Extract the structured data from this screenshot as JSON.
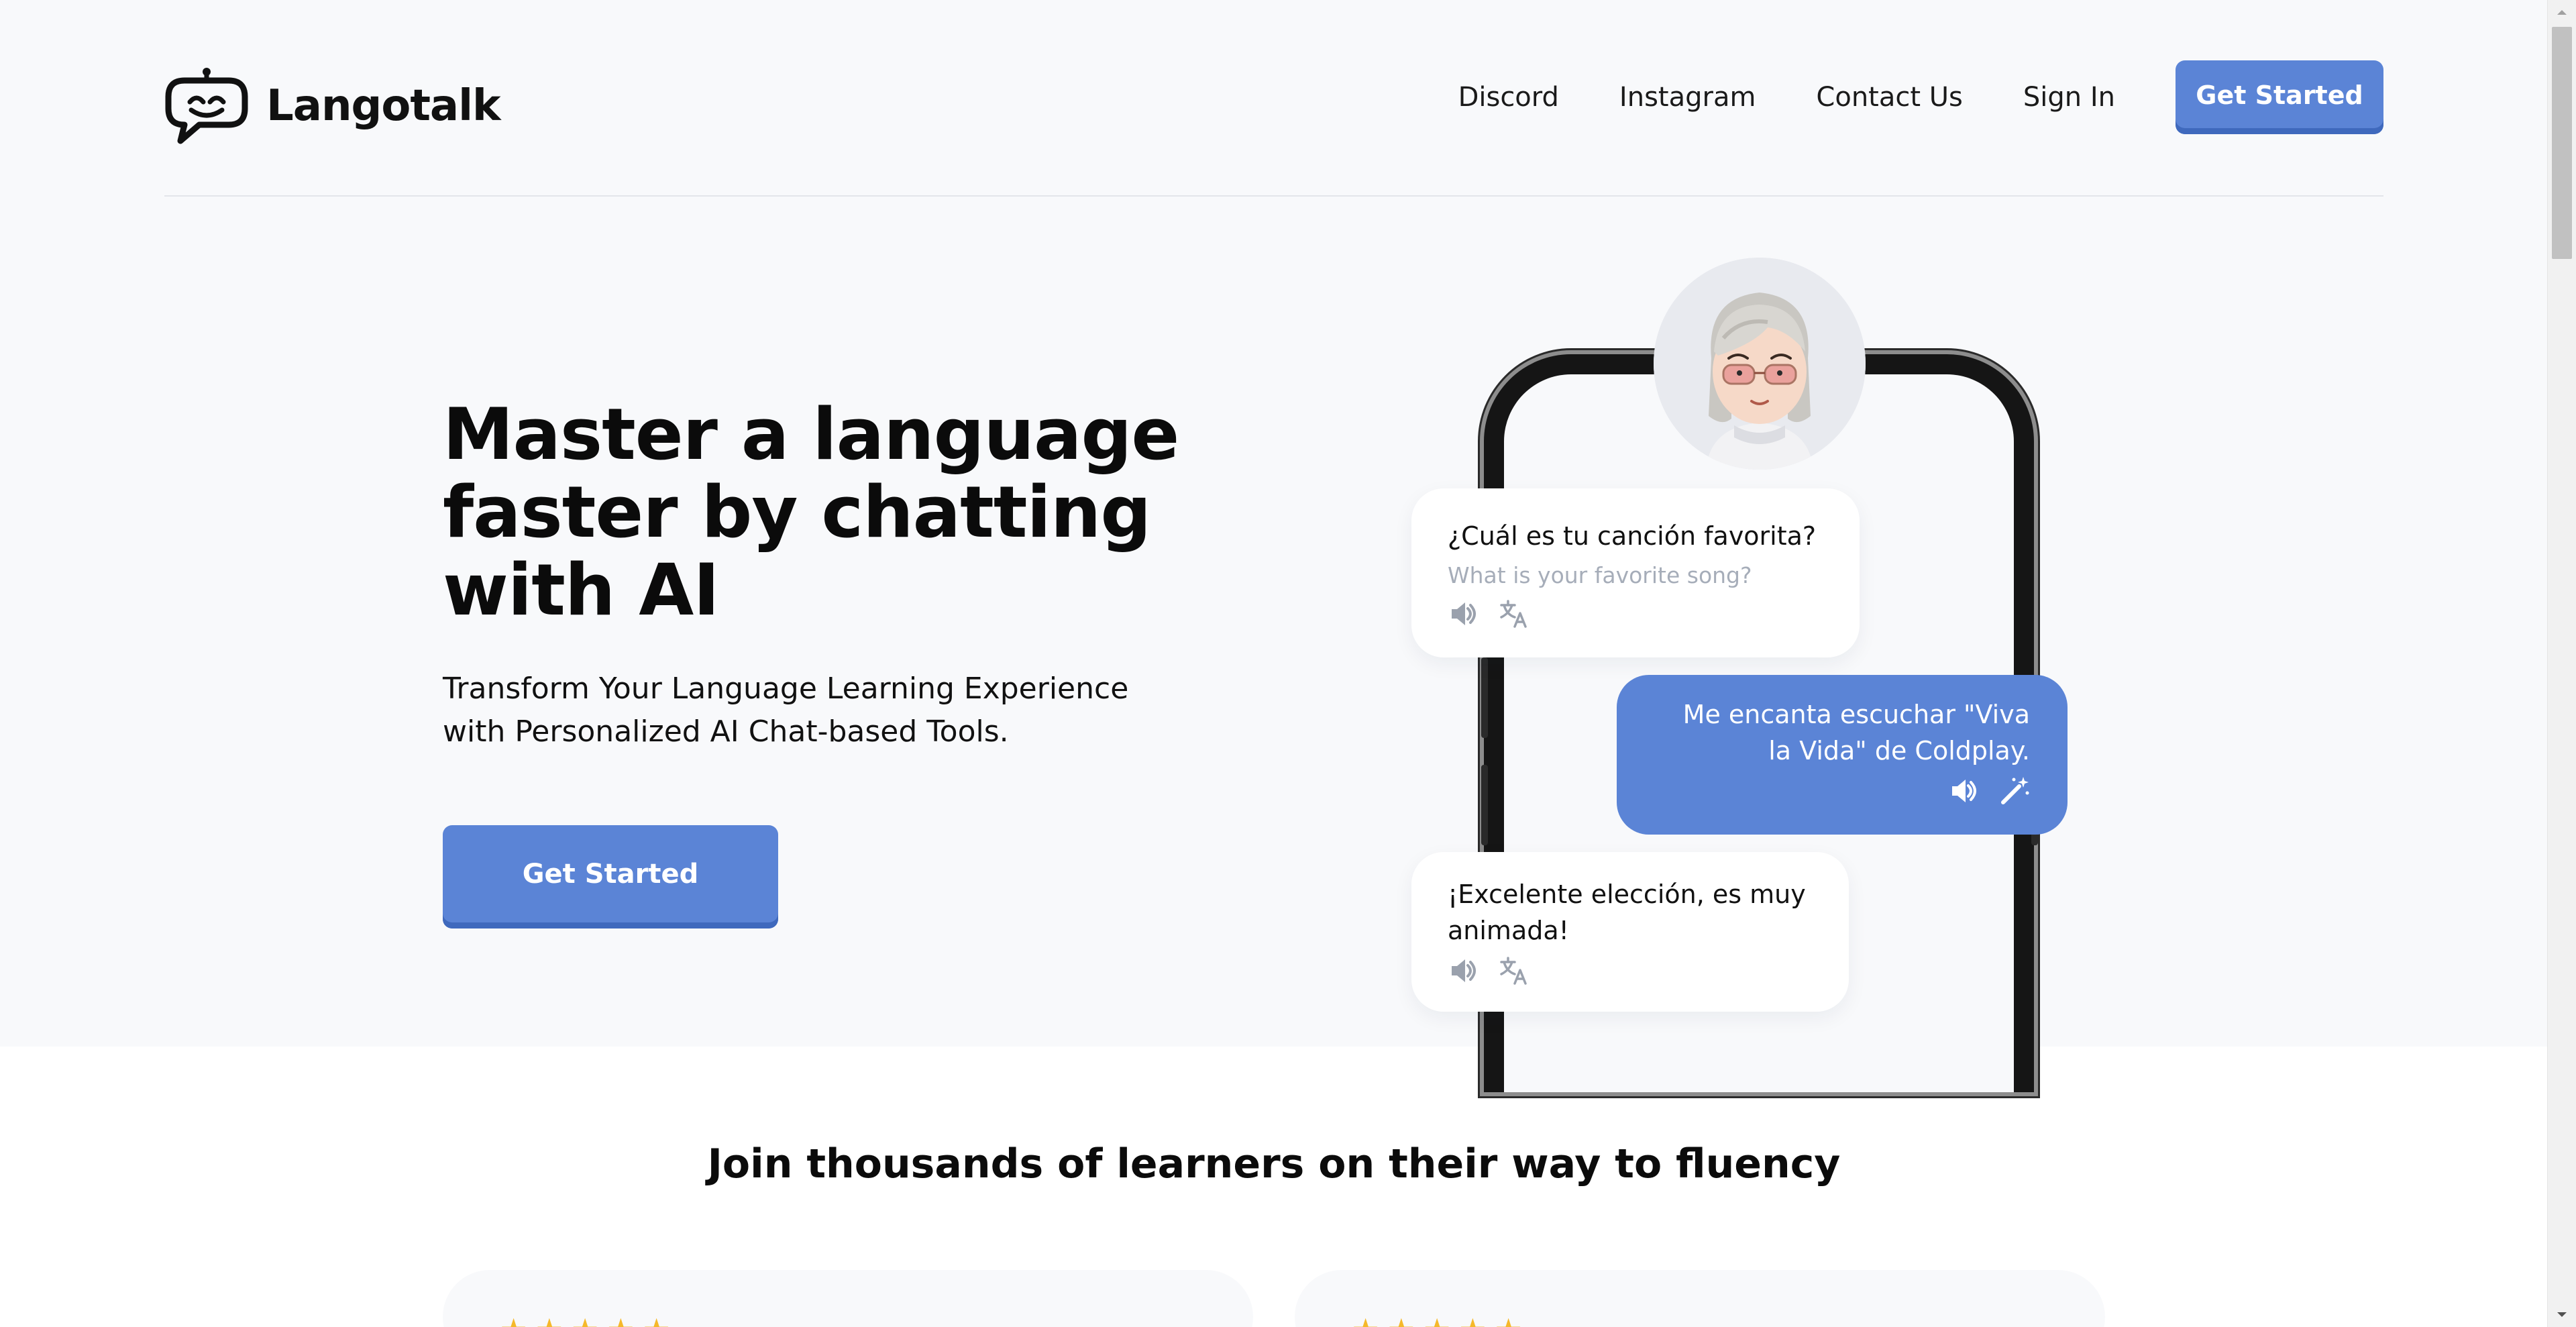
{
  "brand": {
    "name": "Langotalk",
    "logo_icon": "chat-bubble-smile-icon"
  },
  "nav": {
    "links": [
      {
        "label": "Discord"
      },
      {
        "label": "Instagram"
      },
      {
        "label": "Contact Us"
      },
      {
        "label": "Sign In"
      }
    ],
    "cta_label": "Get Started"
  },
  "hero": {
    "title_lines": [
      "Master a language",
      "faster by chatting",
      "with AI"
    ],
    "subtitle_lines": [
      "Transform Your Language Learning Experience",
      "with Personalized AI Chat-based Tools."
    ],
    "cta_label": "Get Started"
  },
  "chat": {
    "messages": [
      {
        "text": "¿Cuál es tu canción favorita?",
        "translation": "What is your favorite song?",
        "icons": [
          "speaker-icon",
          "translate-icon"
        ]
      },
      {
        "text_lines": [
          "Me encanta escuchar \"Viva",
          "la Vida\" de Coldplay."
        ],
        "icons": [
          "speaker-icon",
          "magic-wand-icon"
        ]
      },
      {
        "text_lines": [
          "¡Excelente elección, es muy",
          "animada!"
        ],
        "icons": [
          "speaker-icon",
          "translate-icon"
        ]
      }
    ],
    "accent_color": "#5b84d6"
  },
  "social_proof": {
    "title": "Join thousands of learners on their way to fluency",
    "cards": [
      {
        "stars": "★★★★★"
      },
      {
        "stars": "★★★★★"
      }
    ],
    "star_color": "#f5b92b"
  }
}
